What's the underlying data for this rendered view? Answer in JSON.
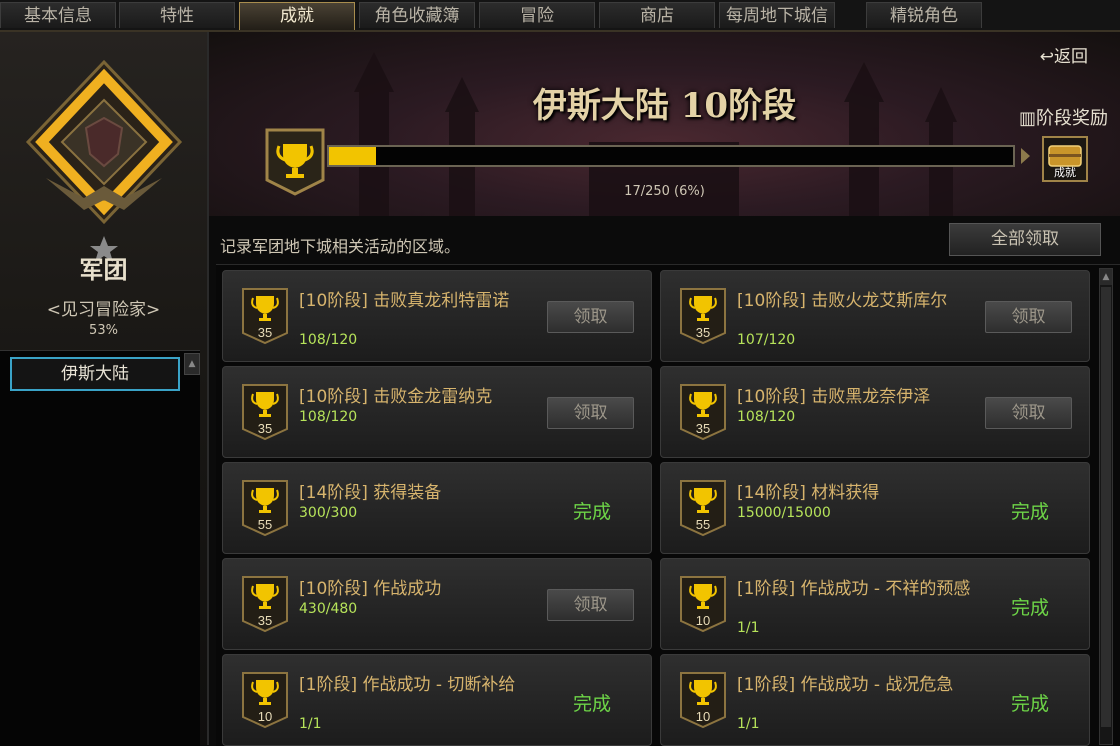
{
  "tabs": [
    {
      "label": "基本信息",
      "active": false
    },
    {
      "label": "特性",
      "active": false
    },
    {
      "label": "成就",
      "active": true
    },
    {
      "label": "角色收藏簿",
      "active": false
    },
    {
      "label": "冒险",
      "active": false
    },
    {
      "label": "商店",
      "active": false
    },
    {
      "label": "每周地下城信息",
      "active": false
    },
    {
      "label": "精锐角色",
      "active": false
    }
  ],
  "sidebar": {
    "rank_title": "军团",
    "rank_subtitle": "<见习冒险家>",
    "rank_percent": "53%",
    "regions": [
      {
        "label": "伊斯大陆",
        "selected": true
      }
    ]
  },
  "banner": {
    "back_label": "返回",
    "stage_title": "伊斯大陆 10阶段",
    "reward_label": "阶段奖励",
    "chest_label": "成就",
    "progress_text": "17/250 (6%)",
    "progress_fraction": 0.068
  },
  "description": "记录军团地下城相关活动的区域。",
  "claim_all_label": "全部领取",
  "achievements": [
    {
      "title": "[10阶段] 击败真龙利特雷诺",
      "progress": "108/120",
      "points": "35",
      "status": "claim",
      "action_label": "领取"
    },
    {
      "title": "[10阶段] 击败火龙艾斯库尔",
      "progress": "107/120",
      "points": "35",
      "status": "claim",
      "action_label": "领取"
    },
    {
      "title": "[10阶段] 击败金龙雷纳克",
      "progress": "108/120",
      "points": "35",
      "status": "claim",
      "action_label": "领取"
    },
    {
      "title": "[10阶段] 击败黑龙奈伊泽",
      "progress": "108/120",
      "points": "35",
      "status": "claim",
      "action_label": "领取"
    },
    {
      "title": "[14阶段] 获得装备",
      "progress": "300/300",
      "points": "55",
      "status": "done",
      "action_label": "完成"
    },
    {
      "title": "[14阶段] 材料获得",
      "progress": "15000/15000",
      "points": "55",
      "status": "done",
      "action_label": "完成"
    },
    {
      "title": "[10阶段] 作战成功",
      "progress": "430/480",
      "points": "35",
      "status": "claim",
      "action_label": "领取"
    },
    {
      "title": "[1阶段] 作战成功 - 不祥的预感",
      "progress": "1/1",
      "points": "10",
      "status": "done",
      "action_label": "完成"
    },
    {
      "title": "[1阶段] 作战成功 - 切断补给",
      "progress": "1/1",
      "points": "10",
      "status": "done",
      "action_label": "完成"
    },
    {
      "title": "[1阶段] 作战成功 - 战况危急",
      "progress": "1/1",
      "points": "10",
      "status": "done",
      "action_label": "完成"
    }
  ],
  "colors": {
    "accent_gold": "#f2c400",
    "done_green": "#6dd447",
    "title_gold": "#d7b46d",
    "selection_blue": "#3aa3c7"
  }
}
